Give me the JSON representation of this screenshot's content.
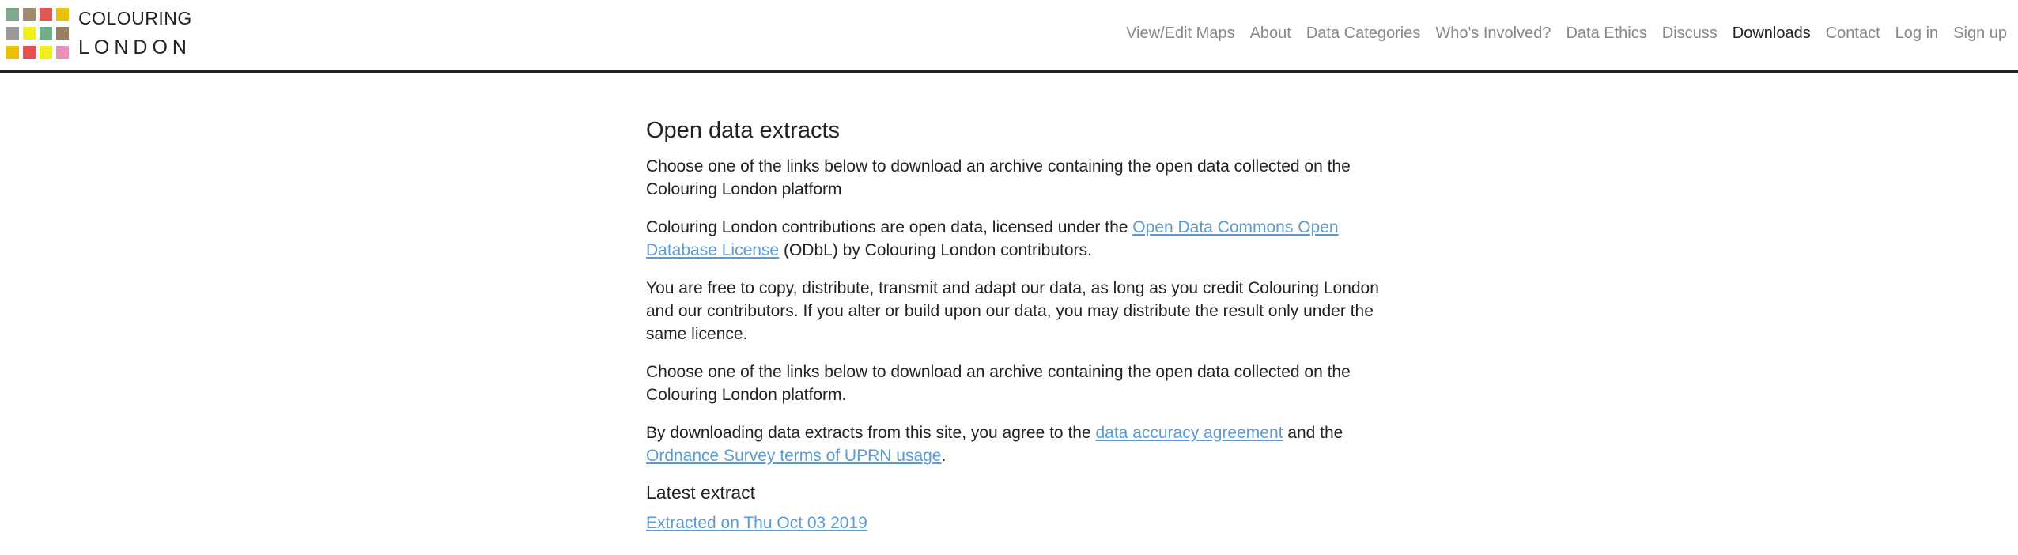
{
  "header": {
    "logo": {
      "line1": "COLOURING",
      "line2": "LONDON",
      "colors": [
        "#7fa98f",
        "#a08a6e",
        "#e05555",
        "#e8c100",
        "#9a9a9a",
        "#f1ef1a",
        "#6fb08a",
        "#9a8060",
        "#e8c100",
        "#e85050",
        "#f1ef1a",
        "#e890b8"
      ]
    },
    "nav": [
      {
        "label": "View/Edit Maps"
      },
      {
        "label": "About"
      },
      {
        "label": "Data Categories"
      },
      {
        "label": "Who's Involved?"
      },
      {
        "label": "Data Ethics"
      },
      {
        "label": "Discuss"
      },
      {
        "label": "Downloads",
        "active": true
      },
      {
        "label": "Contact"
      },
      {
        "label": "Log in"
      },
      {
        "label": "Sign up"
      }
    ]
  },
  "main": {
    "title": "Open data extracts",
    "p1": "Choose one of the links below to download an archive containing the open data collected on the Colouring London platform",
    "p2": {
      "before": "Colouring London contributions are open data, licensed under the ",
      "link": "Open Data Commons Open Database License",
      "after": " (ODbL) by Colouring London contributors."
    },
    "p3": "You are free to copy, distribute, transmit and adapt our data, as long as you credit Colouring London and our contributors. If you alter or build upon our data, you may distribute the result only under the same licence.",
    "p4": "Choose one of the links below to download an archive containing the open data collected on the Colouring London platform.",
    "p5": {
      "before": "By downloading data extracts from this site, you agree to the ",
      "link1": "data accuracy agreement",
      "middle": " and the ",
      "link2": "Ordnance Survey terms of UPRN usage",
      "after": "."
    },
    "latest_heading": "Latest extract",
    "latest_link": "Extracted on Thu Oct 03 2019"
  },
  "colors": {
    "link": "#5a9bd5",
    "nav_text": "#888888",
    "nav_active": "#222222",
    "header_border": "#222222"
  }
}
